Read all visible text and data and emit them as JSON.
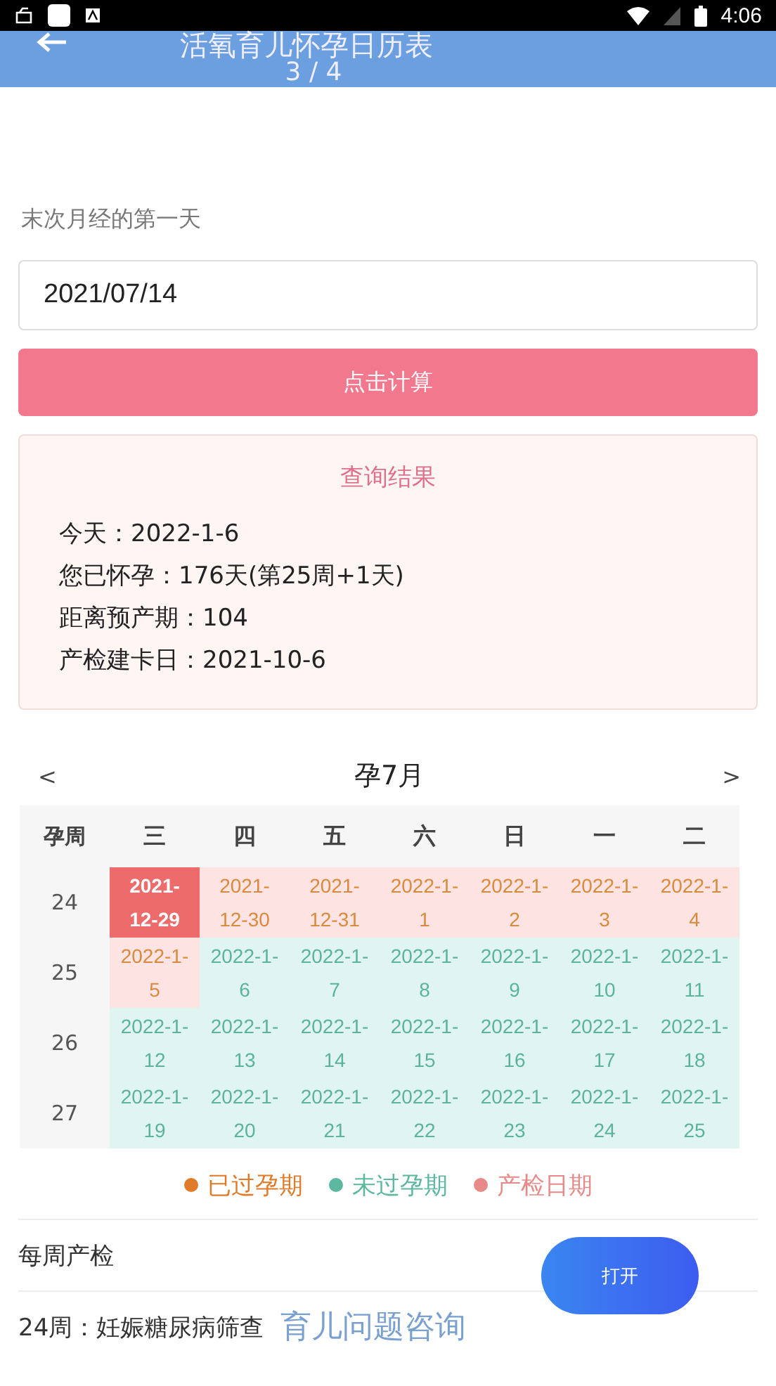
{
  "status_bar": {
    "time": "4:06"
  },
  "header": {
    "title": "活氧育儿怀孕日历表",
    "page": "3 / 4"
  },
  "date_field": {
    "label": "末次月经的第一天",
    "value": "2021/07/14"
  },
  "calculate_button": "点击计算",
  "result": {
    "title": "查询结果",
    "lines": [
      "今天：2022-1-6",
      "您已怀孕：176天(第25周+1天)",
      "距离预产期：104",
      "产检建卡日：2021-10-6"
    ]
  },
  "calendar": {
    "prev": "<",
    "title": "孕7月",
    "next": ">",
    "week_header": "孕周",
    "weekdays": [
      "三",
      "四",
      "五",
      "六",
      "日",
      "一",
      "二"
    ],
    "rows": [
      {
        "week": "24",
        "cells": [
          {
            "date": "2021-12-29",
            "kind": "exam"
          },
          {
            "date": "2021-12-30",
            "kind": "past"
          },
          {
            "date": "2021-12-31",
            "kind": "past"
          },
          {
            "date": "2022-1-1",
            "kind": "past"
          },
          {
            "date": "2022-1-2",
            "kind": "past"
          },
          {
            "date": "2022-1-3",
            "kind": "past"
          },
          {
            "date": "2022-1-4",
            "kind": "past"
          }
        ]
      },
      {
        "week": "25",
        "cells": [
          {
            "date": "2022-1-5",
            "kind": "past"
          },
          {
            "date": "2022-1-6",
            "kind": "future"
          },
          {
            "date": "2022-1-7",
            "kind": "future"
          },
          {
            "date": "2022-1-8",
            "kind": "future"
          },
          {
            "date": "2022-1-9",
            "kind": "future"
          },
          {
            "date": "2022-1-10",
            "kind": "future"
          },
          {
            "date": "2022-1-11",
            "kind": "future"
          }
        ]
      },
      {
        "week": "26",
        "cells": [
          {
            "date": "2022-1-12",
            "kind": "future"
          },
          {
            "date": "2022-1-13",
            "kind": "future"
          },
          {
            "date": "2022-1-14",
            "kind": "future"
          },
          {
            "date": "2022-1-15",
            "kind": "future"
          },
          {
            "date": "2022-1-16",
            "kind": "future"
          },
          {
            "date": "2022-1-17",
            "kind": "future"
          },
          {
            "date": "2022-1-18",
            "kind": "future"
          }
        ]
      },
      {
        "week": "27",
        "cells": [
          {
            "date": "2022-1-19",
            "kind": "future"
          },
          {
            "date": "2022-1-20",
            "kind": "future"
          },
          {
            "date": "2022-1-21",
            "kind": "future"
          },
          {
            "date": "2022-1-22",
            "kind": "future"
          },
          {
            "date": "2022-1-23",
            "kind": "future"
          },
          {
            "date": "2022-1-24",
            "kind": "future"
          },
          {
            "date": "2022-1-25",
            "kind": "future"
          }
        ]
      }
    ]
  },
  "legend": [
    {
      "label": "已过孕期",
      "color": "#e07b2a"
    },
    {
      "label": "未过孕期",
      "color": "#5cb8a0"
    },
    {
      "label": "产检日期",
      "color": "#e88a8a"
    }
  ],
  "weekly_checkup": {
    "title": "每周产检",
    "item": "24周：妊娠糖尿病筛查"
  },
  "open_button": "打开",
  "overlay_text": "育儿问题咨询"
}
